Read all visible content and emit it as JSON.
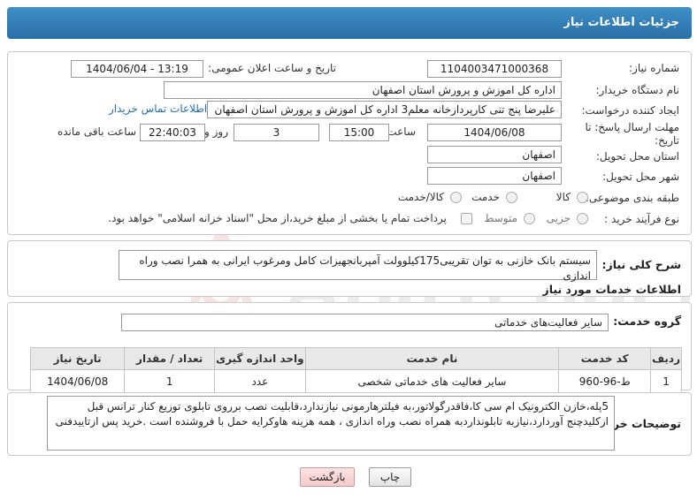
{
  "page": {
    "title": "جزئیات اطلاعات نیاز"
  },
  "form": {
    "need_number_label": "شماره نیاز:",
    "need_number": "1104003471000368",
    "announce_label": "تاریخ و ساعت اعلان عمومی:",
    "announce_value": "1404/06/04 - 13:19",
    "buyer_org_label": "نام دستگاه خریدار:",
    "buyer_org": "اداره کل اموزش و پرورش استان اصفهان",
    "creator_label": "ایجاد کننده درخواست:",
    "creator": "علیرضا پنج تنی کارپردازخانه معلم3 اداره کل اموزش و پرورش استان اصفهان",
    "contact_link": "اطلاعات تماس خریدار",
    "deadline_label": "مهلت ارسال پاسخ: تا تاریخ:",
    "deadline_date": "1404/06/08",
    "time_label": "ساعت",
    "deadline_time": "15:00",
    "days_value": "3",
    "days_label": "روز و",
    "remaining_value": "22:40:03",
    "remaining_label": "ساعت باقی مانده",
    "province_label": "استان محل تحویل:",
    "province": "اصفهان",
    "city_label": "شهر محل تحویل:",
    "city": "اصفهان",
    "category_label": "طبقه بندی موضوعی:",
    "category_options": [
      "کالا",
      "خدمت",
      "کالا/خدمت"
    ],
    "process_label": "نوع فرآیند خرید :",
    "process_options": [
      "جزیی",
      "متوسط"
    ],
    "payment_note": "پرداخت تمام یا بخشی از مبلغ خرید،از محل \"اسناد خزانه اسلامی\" خواهد بود."
  },
  "description": {
    "label": "شرح کلی نیاز:",
    "text": "سیستم بانک خازنی به توان تقریبی175کیلوولت آمپربانجهیزات کامل ومرغوب ایرانی به همرا نصب وراه اندازی"
  },
  "services": {
    "section_title": "اطلاعات خدمات مورد نیاز",
    "group_label": "گروه خدمت:",
    "group_value": "سایر فعالیت‌های خدماتی",
    "table": {
      "headers": [
        "ردیف",
        "کد خدمت",
        "نام خدمت",
        "واحد اندازه گیری",
        "تعداد / مقدار",
        "تاریخ نیاز"
      ],
      "rows": [
        [
          "1",
          "ط-96-960",
          "سایر فعالیت های خدماتی شخصی",
          "عدد",
          "1",
          "1404/06/08"
        ]
      ]
    }
  },
  "buyer_notes": {
    "label": "توضیحات خریدار:",
    "text": "5پله،خازن الکترونیک ام سی کا،فاقدرگولاتور،به فیلترهارمونی نیازندارد،قابلیت نصب برروی تابلوی توزیع کنار ترانس قبل ازکلیدچنج آوردارد،نیازبه تابلونداردبه همراه نصب وراه اندازی ، همه هزینه هاوکرایه حمل با فروشنده است .خرید پس ازتاییدفنی"
  },
  "buttons": {
    "print": "چاپ",
    "back": "بازگشت"
  },
  "colors": {
    "header": "#2a6fa8",
    "link": "#1e6fb8",
    "watermark": "#c0392b"
  }
}
